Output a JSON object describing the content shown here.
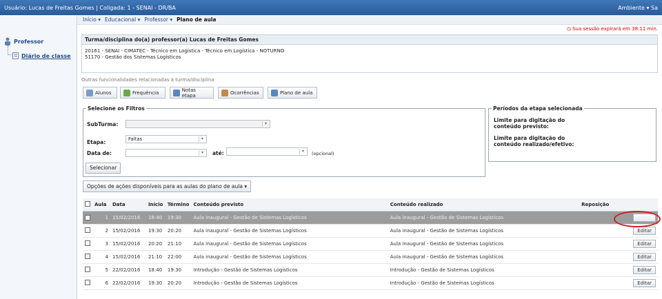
{
  "topbar": {
    "left": "Usuário: Lucas de Freitas Gomes | Coligada: 1 - SENAI - DR/BA",
    "right": "Ambiente ▾  Sa"
  },
  "sidebar": {
    "root": "Professor",
    "child": "Diário de classe"
  },
  "menubar": {
    "items": [
      "Início ▾",
      "Educacional ▾",
      "Professor ▾"
    ],
    "current": "Plano de aula"
  },
  "session": "Sua sessão expirará em 38:11 min.",
  "turma": {
    "header": "Turma/disciplina do(a) professor(a) Lucas de Freitas Gomes",
    "line1": "20161 - SENAI - CIMATEC - Técnico em Logística - Técnico em Logística - NOTURNO",
    "line2": "51170 - Gestão dos Sistemas Logísticos"
  },
  "funcs_title": "Outras funcionalidades relacionadas à turma/disciplina",
  "toolbar": [
    "Alunos",
    "Frequência",
    "Notas etapa",
    "Ocorrências",
    "Plano de aula"
  ],
  "filters": {
    "legend": "Selecione os Filtros",
    "subturma_label": "SubTurma:",
    "etapa_label": "Etapa:",
    "etapa_value": "Faltas",
    "data_de_label": "Data de:",
    "ate_label": "até:",
    "opcional": "(opcional)",
    "selecionar": "Selecionar"
  },
  "periodos": {
    "legend": "Períodos da etapa selecionada",
    "p1": "Limite para digitação do conteúdo previsto:",
    "p2": "Limite para digitação do conteúdo realizado/efetivo:"
  },
  "options_button": "Opções de ações disponíveis para as aulas do plano de aula ▾",
  "table": {
    "headers": [
      "",
      "Aula",
      "Data",
      "Início",
      "Término",
      "Conteúdo previsto",
      "Conteúdo realizado",
      "Reposição",
      ""
    ],
    "edit_label": "Editar",
    "rows": [
      {
        "aula": "1",
        "data": "15/02/2016",
        "inicio": "18:40",
        "termino": "19:30",
        "previsto": "Aula inaugural - Gestão de Sistemas Logísticos",
        "realizado": "Aula inaugural - Gestão de Sistemas Logísticos"
      },
      {
        "aula": "2",
        "data": "15/02/2016",
        "inicio": "19:30",
        "termino": "20:20",
        "previsto": "Aula inaugural - Gestão de Sistemas Logísticos",
        "realizado": "Aula inaugural - Gestão de Sistemas Logísticos"
      },
      {
        "aula": "3",
        "data": "15/02/2016",
        "inicio": "20:20",
        "termino": "21:10",
        "previsto": "Aula inaugural - Gestão de Sistemas Logísticos",
        "realizado": "Aula inaugural - Gestão de Sistemas Logísticos"
      },
      {
        "aula": "4",
        "data": "15/02/2016",
        "inicio": "21:10",
        "termino": "22:00",
        "previsto": "Aula inaugural - Gestão de Sistemas Logísticos",
        "realizado": "Aula inaugural - Gestão de Sistemas Logísticos"
      },
      {
        "aula": "5",
        "data": "22/02/2016",
        "inicio": "18:40",
        "termino": "19:30",
        "previsto": "Introdução - Gestão de Sistemas Logísticos",
        "realizado": "Introdução - Gestão de Sistemas Logísticos"
      },
      {
        "aula": "6",
        "data": "22/02/2016",
        "inicio": "19:30",
        "termino": "20:20",
        "previsto": "Introdução - Gestão de Sistemas Logísticos",
        "realizado": "Introdução - Gestão de Sistemas Logísticos"
      }
    ]
  }
}
